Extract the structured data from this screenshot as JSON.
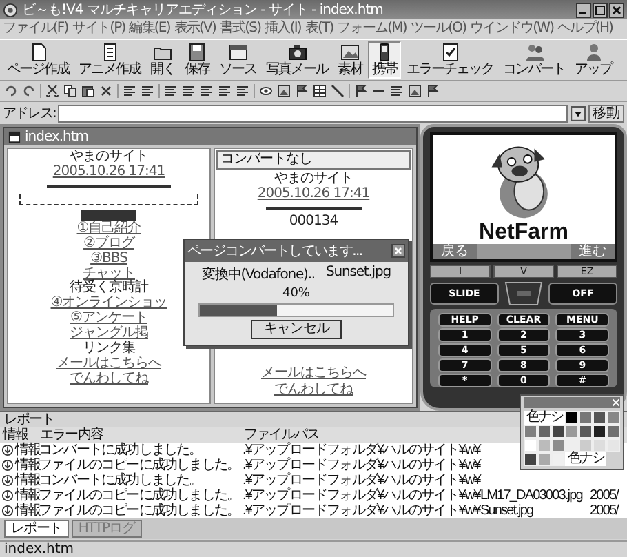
{
  "window": {
    "title": "ビ～も!V4 マルチキャリアエディション - サイト - index.htm"
  },
  "menu": [
    "ファイル(F)",
    "サイト(P)",
    "編集(E)",
    "表示(V)",
    "書式(S)",
    "挿入(I)",
    "表(T)",
    "フォーム(M)",
    "ツール(O)",
    "ウインドウ(W)",
    "ヘルプ(H)"
  ],
  "toolbar": [
    {
      "label": "ページ作成",
      "selected": false
    },
    {
      "label": "アニメ作成",
      "selected": false
    },
    {
      "label": "開く",
      "selected": false
    },
    {
      "label": "保存",
      "selected": false
    },
    {
      "label": "ソース",
      "selected": false
    },
    {
      "label": "写真メール",
      "selected": false
    },
    {
      "label": "素材",
      "selected": false
    },
    {
      "label": "携帯",
      "selected": true
    },
    {
      "label": "エラーチェック",
      "selected": false
    },
    {
      "label": "コンバート",
      "selected": false
    },
    {
      "label": "アップ",
      "selected": false
    }
  ],
  "address": {
    "label": "アドレス:",
    "button": "移動"
  },
  "document": {
    "title": "index.htm",
    "lines": [
      {
        "kind": "text",
        "text": "やまのサイト"
      },
      {
        "kind": "link",
        "text": "2005.10.26 17:41"
      },
      {
        "kind": "rule"
      },
      {
        "kind": "dashed-box"
      },
      {
        "kind": "marker"
      },
      {
        "kind": "link",
        "text": "①自己紹介"
      },
      {
        "kind": "link",
        "text": "②ブログ"
      },
      {
        "kind": "link",
        "text": "③BBS"
      },
      {
        "kind": "link",
        "text": "チャット"
      },
      {
        "kind": "text",
        "text": "待受く京時計"
      },
      {
        "kind": "link",
        "text": "④オンラインショッ"
      },
      {
        "kind": "link",
        "text": "⑤アンケート"
      },
      {
        "kind": "link",
        "text": "ジャングル掲"
      },
      {
        "kind": "text",
        "text": "リンク集"
      },
      {
        "kind": "link",
        "text": "メールはこちらへ"
      },
      {
        "kind": "link",
        "text": "でんわしてね"
      }
    ]
  },
  "preview": {
    "mode": "コンバートなし",
    "top": [
      {
        "kind": "text",
        "text": "やまのサイト"
      },
      {
        "kind": "link",
        "text": "2005.10.26 17:41"
      },
      {
        "kind": "rule"
      },
      {
        "kind": "text",
        "text": "000134"
      }
    ],
    "bottom": [
      {
        "kind": "link",
        "text": "メールはこちらへ"
      },
      {
        "kind": "link",
        "text": "でんわしてね"
      }
    ]
  },
  "dialog": {
    "title": "ページコンバートしています...",
    "status": "変換中(Vodafone)..",
    "file": "Sunset.jpg",
    "percent": "40%",
    "level": 0.4,
    "button": "キャンセル"
  },
  "phone": {
    "brand": "NetFarm",
    "soft_keys": [
      "戻る",
      "進む"
    ],
    "function_keys": [
      "I",
      "V",
      "EZ"
    ],
    "side_keys": [
      "SLIDE",
      "OFF"
    ],
    "keys": [
      "HELP",
      "CLEAR",
      "MENU",
      "1",
      "2",
      "3",
      "4",
      "5",
      "6",
      "7",
      "8",
      "9",
      "*",
      "0",
      "#"
    ]
  },
  "report": {
    "title": "レポート",
    "columns": [
      "情報",
      "エラー内容",
      "ファイルパス"
    ],
    "rows": [
      {
        "type": "情報",
        "message": "コンバートに成功しました。",
        "path": ".¥アップロードフォルダ¥ハルのサイト¥w¥"
      },
      {
        "type": "情報",
        "message": "ファイルのコピーに成功しました。",
        "path": ".¥アップロードフォルダ¥ハルのサイト¥w¥"
      },
      {
        "type": "情報",
        "message": "コンバートに成功しました。",
        "path": ".¥アップロードフォルダ¥ハルのサイト¥w¥"
      },
      {
        "type": "情報",
        "message": "ファイルのコピーに成功しました。",
        "path": ".¥アップロードフォルダ¥ハルのサイト¥w¥LM17_DA03003.jpg",
        "date": "2005/"
      },
      {
        "type": "情報",
        "message": "ファイルのコピーに成功しました。",
        "path": ".¥アップロードフォルダ¥ハルのサイト¥w¥Sunset.jpg",
        "date": "2005/"
      }
    ]
  },
  "palette": {
    "cells": [
      {
        "kind": "none",
        "label": "色ナシ"
      },
      {
        "kind": "swatch",
        "color": "#000000"
      },
      {
        "kind": "swatch",
        "color": "#777777"
      },
      {
        "kind": "swatch",
        "color": "#555555"
      },
      {
        "kind": "swatch",
        "color": "#888888"
      },
      {
        "kind": "swatch",
        "color": "#808080"
      },
      {
        "kind": "swatch",
        "color": "#666666"
      },
      {
        "kind": "swatch",
        "color": "#444444"
      },
      {
        "kind": "swatch",
        "color": "#999999"
      },
      {
        "kind": "swatch",
        "color": "#5a5a5a"
      },
      {
        "kind": "swatch",
        "color": "#222222"
      },
      {
        "kind": "swatch",
        "color": "#707070"
      },
      {
        "kind": "swatch",
        "color": "#ffffff"
      },
      {
        "kind": "swatch",
        "color": "#bbbbbb"
      },
      {
        "kind": "swatch",
        "color": "#8c8c8c"
      },
      {
        "kind": "swatch",
        "color": "#eeeeee"
      },
      {
        "kind": "swatch",
        "color": "#cccccc"
      },
      {
        "kind": "swatch",
        "color": "#dddddd"
      },
      {
        "kind": "swatch",
        "color": "#e6e6e6"
      },
      {
        "kind": "swatch",
        "color": "#444444"
      },
      {
        "kind": "swatch",
        "color": "#aaaaaa"
      },
      {
        "kind": "swatch",
        "color": "#f0f0f0"
      },
      {
        "kind": "none",
        "label": "色ナシ"
      }
    ]
  },
  "report_tabs": [
    {
      "label": "レポート",
      "selected": true
    },
    {
      "label": "HTTPログ",
      "selected": false
    }
  ],
  "status_bar": {
    "text": "index.htm"
  }
}
